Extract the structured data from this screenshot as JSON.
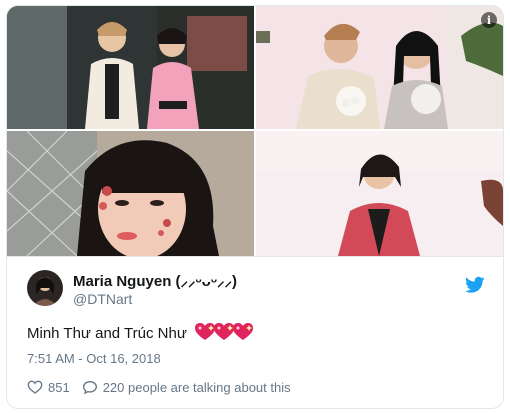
{
  "card": {
    "info_icon": "info-icon",
    "photos": [
      {
        "id": "photo-1",
        "desc_colors": [
          "#7a8a8a",
          "#f6a4b7"
        ]
      },
      {
        "id": "photo-2",
        "desc_colors": [
          "#f7dfe4",
          "#e9d7c3"
        ]
      },
      {
        "id": "photo-3",
        "desc_colors": [
          "#b9a99a",
          "#f1c1b1"
        ]
      },
      {
        "id": "photo-4",
        "desc_colors": [
          "#f6eeee",
          "#cf4a57"
        ]
      }
    ]
  },
  "user": {
    "display_name": "Maria Nguyen (⸝⸝ᵕᴗᵕ⸝⸝)",
    "handle": "@DTNart",
    "avatar_icon": "avatar"
  },
  "tweet": {
    "text": "Minh Thư and Trúc Như",
    "emoji_icon": "sparkling-heart-icon",
    "timestamp": "7:51 AM - Oct 16, 2018"
  },
  "actions": {
    "likes": "851",
    "replies_text": "220 people are talking about this"
  },
  "colors": {
    "brand": "#1da1f2",
    "secondary_text": "#657786",
    "heart": "#e0245e"
  }
}
